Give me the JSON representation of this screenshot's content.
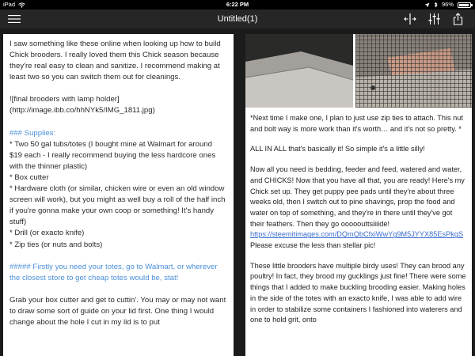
{
  "status_bar": {
    "device": "iPad",
    "time": "6:22 PM",
    "battery_percent": "96%",
    "battery_level": 0.96
  },
  "toolbar": {
    "title": "Untitled(1)",
    "menu_icon": "hamburger-menu-icon",
    "buttons": [
      "split-view-icon",
      "sliders-icon",
      "share-icon"
    ]
  },
  "editor": {
    "paragraphs": [
      {
        "style": "normal",
        "text": "I saw something like these online when looking up how to build Chick brooders. I really loved them this Chick season because they're real easy to clean and sanitize. I recommend making at least two so you can switch them out for cleanings."
      },
      {
        "style": "normal",
        "text": "![final brooders with lamp holder] (http://image.ibb.co/hhNYk5/IMG_1811.jpg)"
      },
      {
        "style": "list",
        "heading": "### Supplies:",
        "items": [
          "* Two 50 gal tubs/totes (I bought mine at Walmart for around $19 each - I really recommend buying the less hardcore ones with the thinner plastic)",
          "* Box cutter",
          "* Hardware cloth (or similar, chicken wire or even an old window screen will work), but you might as well buy a roll of the half inch if you're gonna make your own coop or something! It's handy stuff)",
          "* Drill (or exacto knife)",
          "* Zip ties (or nuts and bolts)"
        ]
      },
      {
        "style": "blue",
        "text": "##### Firstly you need your totes, go to Walmart, or wherever the closest store to get cheap totes would be, stat!"
      },
      {
        "style": "normal",
        "text": "Grab your box cutter and get to cuttin'. You may or may not want to draw some sort of guide on your lid first. One thing I would change about the hole I cut in my lid is to put"
      }
    ]
  },
  "preview": {
    "photo_left": "tote-lid-photo",
    "photo_right": "hardware-cloth-photo",
    "caption": "*Next time I make one, I plan to just use zip ties to attach. This nut and bolt way is more work than it's worth… and it's not so pretty. *",
    "all_in_all": "ALL IN ALL that's basically it! So simple it's a little silly!",
    "para_before_link": "Now all you need is bedding, feeder and feed, watered and water, and CHICKS! Now that you have all that, you are ready! Here's my Chick set up. They get puppy pee pads until they're about three weeks old, then I switch out to pine shavings, prop the food and water on top of something, and they're in there until they've got their feathers. Then they go ooooouttsiiiide!",
    "link": "https://steemitimages.com/DQmQbCfxiWwYg9M5JYYX85EsPkgS",
    "after_link": "Please excuse the less than stellar pic!",
    "last_para": "These little brooders have multiple birdy uses! They can brood any poultry! In fact, they brood my gucklings just fine! There were some things that I added to make buckling brooding easier. Making holes in the side of the totes with an exacto knife, I was able to add wire in order to stabilize some containers I fashioned into waterers and one to hold grit, onto"
  }
}
